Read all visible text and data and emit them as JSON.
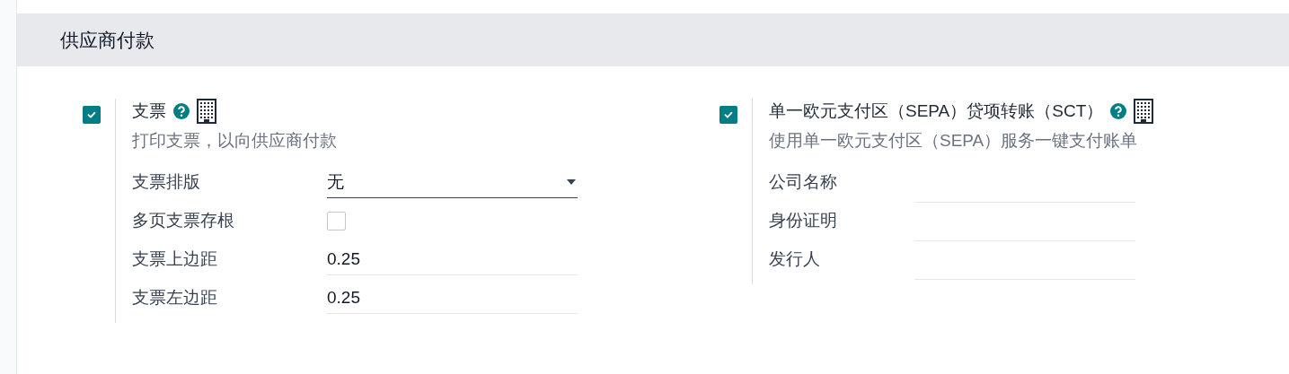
{
  "section": {
    "title": "供应商付款"
  },
  "settings": [
    {
      "title": "支票",
      "enabled": true,
      "description": "打印支票，以向供应商付款",
      "fields": [
        {
          "kind": "select",
          "label": "支票排版",
          "value": "无"
        },
        {
          "kind": "checkbox",
          "label": "多页支票存根",
          "checked": false
        },
        {
          "kind": "text",
          "label": "支票上边距",
          "value": "0.25"
        },
        {
          "kind": "text",
          "label": "支票左边距",
          "value": "0.25"
        }
      ]
    },
    {
      "title": "单一欧元支付区（SEPA）贷项转账（SCT）",
      "enabled": true,
      "description": "使用单一欧元支付区（SEPA）服务一键支付账单",
      "fields": [
        {
          "kind": "text",
          "label": "公司名称"
        },
        {
          "kind": "text",
          "label": "身份证明"
        },
        {
          "kind": "text",
          "label": "发行人"
        }
      ]
    }
  ]
}
